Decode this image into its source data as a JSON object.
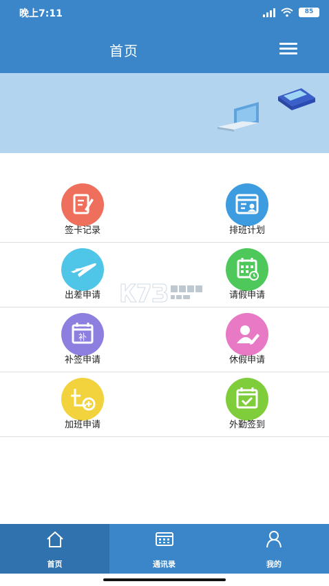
{
  "status_bar": {
    "time": "晚上7:11",
    "battery": "85"
  },
  "header": {
    "title": "首页",
    "menu_icon": "menu-icon"
  },
  "grid": [
    {
      "label": "签卡记录",
      "icon": "sign-record-icon",
      "color": "#ee6f5b"
    },
    {
      "label": "排班计划",
      "icon": "schedule-icon",
      "color": "#3d9be0"
    },
    {
      "label": "出差申请",
      "icon": "airplane-icon",
      "color": "#4fc6e8"
    },
    {
      "label": "请假申请",
      "icon": "calendar-leave-icon",
      "color": "#4ec85a"
    },
    {
      "label": "补签申请",
      "icon": "calendar-patch-icon",
      "color": "#8c7fe0"
    },
    {
      "label": "休假申请",
      "icon": "vacation-icon",
      "color": "#e879c4"
    },
    {
      "label": "加班申请",
      "icon": "overtime-icon",
      "color": "#f2d33d"
    },
    {
      "label": "外勤签到",
      "icon": "field-checkin-icon",
      "color": "#7fcd3b"
    }
  ],
  "bottom_nav": [
    {
      "label": "首页",
      "icon": "home-icon",
      "active": true
    },
    {
      "label": "通讯录",
      "icon": "contacts-icon",
      "active": false
    },
    {
      "label": "我的",
      "icon": "profile-icon",
      "active": false
    }
  ],
  "colors": {
    "primary": "#3a86c8",
    "primary_dark": "#2f72ae",
    "banner": "#b3d4ee"
  }
}
